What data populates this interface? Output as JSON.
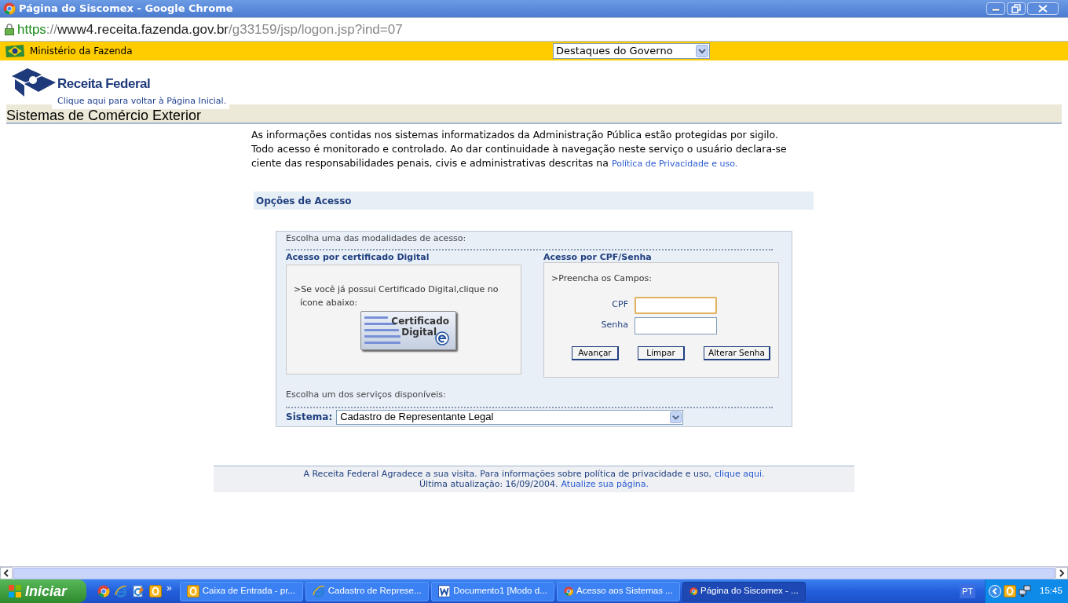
{
  "window": {
    "title": "Página do Siscomex - Google Chrome"
  },
  "address_bar": {
    "scheme": "https",
    "separator": "://",
    "host": "www4.receita.fazenda.gov.br",
    "path": "/g33159/jsp/logon.jsp?ind=07"
  },
  "gov_bar": {
    "ministry": "Ministério da Fazenda",
    "select_value": "Destaques do Governo"
  },
  "header": {
    "logo_text": "Receita Federal",
    "home_link": "Clique aqui para voltar à Página Inicial.",
    "title": "Sistemas de Comércio Exterior"
  },
  "notice": {
    "text": "As informações contidas nos sistemas informatizados da Administração Pública estão protegidas por sigilo.\nTodo acesso é monitorado e controlado. Ao dar continuidade à navegação neste serviço o usuário declara-se\nciente das responsabilidades penais, civis e administrativas descritas na",
    "link": "Política de Privacidade e uso."
  },
  "access": {
    "heading": "Opções de Acesso",
    "choose_mode": "Escolha uma das modalidades de acesso:",
    "certificate": {
      "heading": "Acesso por certificado Digital",
      "instruction": ">Se você já possui Certificado Digital,clique no ícone abaixo:",
      "button_lines": [
        "Certificado",
        "Digital"
      ]
    },
    "password": {
      "heading": "Acesso por CPF/Senha",
      "instruction": ">Preencha os Campos:",
      "fields": [
        {
          "label": "CPF",
          "focused": true
        },
        {
          "label": "Senha",
          "focused": false
        }
      ],
      "buttons": [
        "Avançar",
        "Limpar",
        "Alterar Senha"
      ]
    },
    "choose_service": "Escolha um dos serviços disponíveis:",
    "system_label": "Sistema:",
    "system_value": "Cadastro de Representante Legal"
  },
  "footer": {
    "line1": "A Receita Federal Agradece a sua visita. Para informações sobre política de privacidade e uso,",
    "link1": "clique aqui.",
    "line2": "Última atualização: 16/09/2004.",
    "link2": "Atualize sua página."
  },
  "taskbar": {
    "start": "Iniciar",
    "quick_launch": [
      {
        "kind": "chrome"
      },
      {
        "kind": "ie"
      },
      {
        "kind": "ie-edit"
      },
      {
        "kind": "outlook"
      }
    ],
    "more": "»",
    "tasks": [
      {
        "kind": "outlook",
        "label": "Caixa de Entrada - pr...",
        "selected": false
      },
      {
        "kind": "ie",
        "label": "Cadastro de Represe...",
        "selected": false
      },
      {
        "kind": "word",
        "label": "Documento1 [Modo d...",
        "selected": false
      },
      {
        "kind": "chrome",
        "label": "Acesso aos Sistemas ...",
        "selected": false
      },
      {
        "kind": "chrome",
        "label": "Página do Siscomex - ...",
        "selected": true
      }
    ],
    "language": "PT",
    "clock": "15:45"
  }
}
